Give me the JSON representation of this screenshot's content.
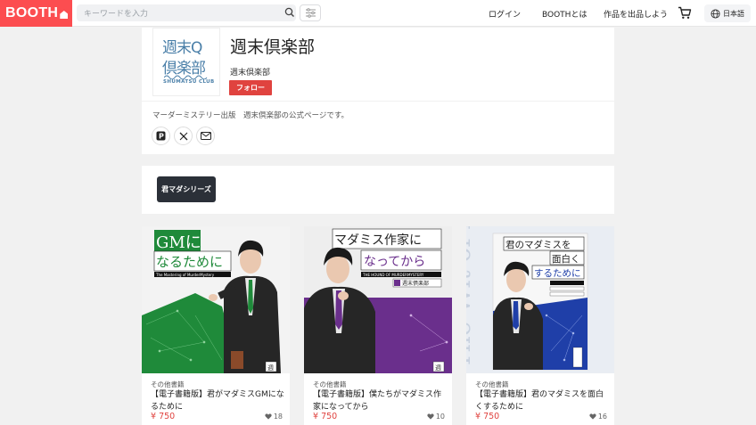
{
  "header": {
    "logo": "BOOTH",
    "search_placeholder": "キーワードを入力",
    "nav": {
      "login": "ログイン",
      "about": "BOOTHとは",
      "sell": "作品を出品しよう"
    },
    "language": "日本語"
  },
  "shop": {
    "logo_line1": "週末Q",
    "logo_line2": "倶楽部",
    "logo_caption": "SHUMATSU CLUB",
    "title": "週末倶楽部",
    "subtitle": "週末倶楽部",
    "follow_label": "フォロー",
    "description": "マーダーミステリー出版　週末倶楽部の公式ページです。",
    "social": [
      "pixiv-icon",
      "x-icon",
      "mail-icon"
    ]
  },
  "categories": [
    {
      "label": "君マダシリーズ"
    }
  ],
  "products": [
    {
      "category": "その他書籍",
      "title": "【電子書籍版】君がマダミスGMになるために",
      "price": "¥ 750",
      "likes": "18",
      "cover": {
        "line1": "GMに",
        "line2": "なるために",
        "subtitle": "The Mastering of MurderMystery",
        "seal": "週",
        "accent": "#1f8a3a"
      }
    },
    {
      "category": "その他書籍",
      "title": "【電子書籍版】僕たちがマダミス作家になってから",
      "price": "¥ 750",
      "likes": "10",
      "cover": {
        "line1": "マダミス作家に",
        "line2": "なってから",
        "subtitle": "THE HOUND OF MURDERMYSTERY",
        "seal": "週",
        "author": "週末倶楽部",
        "accent": "#6a2f8c"
      }
    },
    {
      "category": "その他書籍",
      "title": "【電子書籍版】君のマダミスを面白くするために",
      "price": "¥ 750",
      "likes": "16",
      "cover": {
        "line1": "君のマダミスを",
        "line2": "面白く",
        "line3": "するために",
        "bg_text": "The Wit of Four",
        "accent": "#1f3fa8"
      }
    }
  ],
  "colors": {
    "brand": "#fc4d50",
    "follow": "#e0433f",
    "price": "#e0433f",
    "category_button": "#2b3038"
  }
}
